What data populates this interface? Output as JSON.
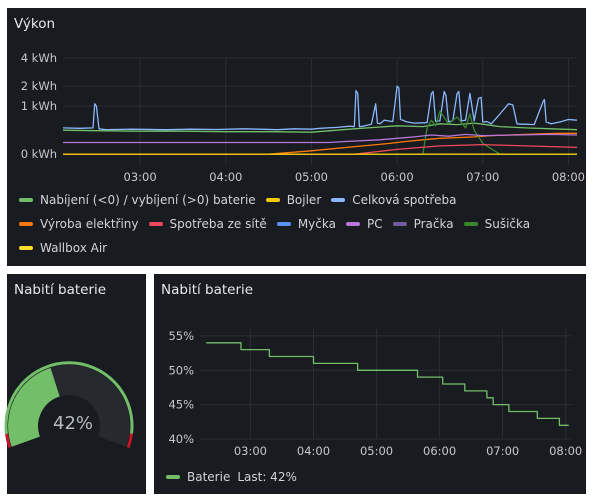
{
  "panels": {
    "vykon": {
      "title": "Výkon"
    },
    "gauge": {
      "title": "Nabití baterie",
      "value": 42,
      "value_text": "42%",
      "min": 0,
      "max": 100,
      "color": "#73bf69"
    },
    "battery": {
      "title": "Nabití baterie"
    }
  },
  "colors": {
    "bg": "#181b1f",
    "grid": "#2b2e33",
    "text": "#d8d9da"
  },
  "chart_data": [
    {
      "type": "line",
      "title": "Výkon",
      "y_ticks": [
        "4 kWh",
        "2 kWh",
        "1 kWh",
        "0 kWh"
      ],
      "y_tick_values": [
        4000,
        2000,
        1000,
        0
      ],
      "x_ticks": [
        "03:00",
        "04:00",
        "05:00",
        "06:00",
        "07:00",
        "08:00"
      ],
      "x_tick_values": [
        3,
        4,
        5,
        6,
        7,
        8
      ],
      "xlim": [
        2.1,
        8.1
      ],
      "y_scale": "sqrt",
      "ylim": [
        -50,
        4000
      ],
      "legend_rows": [
        [
          {
            "name": "Nabíjení (<0) / vybíjení (>0) baterie",
            "color": "#73bf69"
          },
          {
            "name": "Bojler",
            "color": "#f2cc0c"
          },
          {
            "name": "Celková spotřeba",
            "color": "#8ab8ff"
          }
        ],
        [
          {
            "name": "Výroba elektřiny",
            "color": "#ff780a"
          },
          {
            "name": "Spotřeba ze sítě",
            "color": "#f2495c"
          },
          {
            "name": "Myčka",
            "color": "#5794f2"
          },
          {
            "name": "PC",
            "color": "#b877d9"
          },
          {
            "name": "Pračka",
            "color": "#705da0"
          },
          {
            "name": "Sušička",
            "color": "#37872d"
          }
        ],
        [
          {
            "name": "Wallbox Air",
            "color": "#fade2a"
          }
        ]
      ],
      "series": [
        {
          "name": "Celková spotřeba",
          "color": "#8ab8ff",
          "x": [
            2.1,
            2.3,
            2.45,
            2.47,
            2.49,
            2.52,
            2.6,
            2.9,
            3.3,
            3.6,
            3.9,
            4.2,
            4.4,
            4.6,
            4.8,
            5.0,
            5.1,
            5.3,
            5.45,
            5.5,
            5.52,
            5.54,
            5.56,
            5.6,
            5.7,
            5.75,
            5.77,
            5.8,
            5.85,
            5.9,
            5.95,
            6.0,
            6.02,
            6.04,
            6.07,
            6.1,
            6.2,
            6.35,
            6.4,
            6.42,
            6.45,
            6.5,
            6.55,
            6.57,
            6.6,
            6.65,
            6.7,
            6.72,
            6.75,
            6.8,
            6.85,
            6.9,
            6.95,
            6.98,
            7.0,
            7.05,
            7.1,
            7.2,
            7.3,
            7.35,
            7.4,
            7.45,
            7.5,
            7.6,
            7.7,
            7.72,
            7.74,
            7.8,
            7.9,
            8.0,
            8.1
          ],
          "values": [
            300,
            290,
            300,
            1100,
            1000,
            280,
            260,
            270,
            260,
            270,
            265,
            280,
            270,
            260,
            280,
            270,
            290,
            310,
            340,
            330,
            1750,
            1600,
            330,
            340,
            390,
            1100,
            420,
            400,
            500,
            480,
            460,
            2000,
            1900,
            520,
            500,
            460,
            420,
            430,
            1600,
            1700,
            470,
            480,
            1700,
            1500,
            460,
            480,
            1600,
            1700,
            480,
            500,
            1600,
            480,
            1350,
            1400,
            450,
            460,
            400,
            700,
            1100,
            1050,
            400,
            390,
            390,
            380,
            1150,
            1300,
            450,
            400,
            450,
            520,
            500
          ]
        },
        {
          "name": "Nabíjení (<0) / vybíjení (>0) baterie",
          "color": "#73bf69",
          "x": [
            2.1,
            2.5,
            3.0,
            3.5,
            4.0,
            4.5,
            5.0,
            5.5,
            5.8,
            6.0,
            6.3,
            6.5,
            6.7,
            6.9,
            7.0,
            7.2,
            7.5,
            7.8,
            8.1
          ],
          "values": [
            250,
            240,
            230,
            230,
            220,
            220,
            210,
            280,
            320,
            350,
            330,
            400,
            380,
            420,
            390,
            330,
            300,
            280,
            260
          ]
        },
        {
          "name": "Výroba elektřiny",
          "color": "#ff780a",
          "x": [
            2.1,
            4.5,
            5.0,
            5.3,
            5.6,
            5.9,
            6.1,
            6.3,
            6.5,
            6.7,
            6.9,
            7.1,
            7.3,
            7.5,
            7.7,
            7.9,
            8.1
          ],
          "values": [
            0,
            0,
            5,
            15,
            30,
            50,
            70,
            90,
            110,
            120,
            130,
            150,
            160,
            170,
            180,
            190,
            190
          ]
        },
        {
          "name": "Sušička",
          "color": "#37872d",
          "x": [
            2.1,
            6.3,
            6.35,
            6.4,
            6.45,
            6.5,
            6.6,
            6.7,
            6.8,
            6.85,
            6.9,
            7.0,
            7.2,
            8.1
          ],
          "values": [
            0,
            0,
            300,
            500,
            350,
            800,
            400,
            600,
            300,
            700,
            250,
            50,
            0,
            0
          ]
        },
        {
          "name": "PC",
          "color": "#b877d9",
          "x": [
            2.1,
            5.2,
            5.4,
            5.8,
            6.0,
            6.2,
            6.4,
            6.6,
            6.8,
            7.0,
            7.4,
            7.8,
            8.1
          ],
          "values": [
            60,
            60,
            70,
            90,
            110,
            130,
            160,
            140,
            170,
            150,
            160,
            170,
            160
          ]
        },
        {
          "name": "Spotřeba ze sítě",
          "color": "#f2495c",
          "x": [
            2.1,
            5.5,
            6.0,
            6.5,
            7.0,
            7.5,
            8.1
          ],
          "values": [
            0,
            0,
            10,
            30,
            40,
            30,
            20
          ]
        },
        {
          "name": "Bojler",
          "color": "#f2cc0c",
          "x": [
            2.1,
            8.1
          ],
          "values": [
            0,
            0
          ]
        }
      ]
    },
    {
      "type": "line",
      "title": "Nabití baterie",
      "y_ticks": [
        "55%",
        "50%",
        "45%",
        "40%"
      ],
      "y_tick_values": [
        55,
        50,
        45,
        40
      ],
      "x_ticks": [
        "03:00",
        "04:00",
        "05:00",
        "06:00",
        "07:00",
        "08:00"
      ],
      "x_tick_values": [
        3,
        4,
        5,
        6,
        7,
        8
      ],
      "xlim": [
        2.2,
        8.1
      ],
      "ylim": [
        40,
        56
      ],
      "legend": [
        {
          "name": "Baterie",
          "extra": "Last: 42%",
          "color": "#73bf69"
        }
      ],
      "series": [
        {
          "name": "Baterie",
          "color": "#73bf69",
          "step": true,
          "x": [
            2.3,
            2.85,
            3.3,
            4.0,
            4.7,
            5.3,
            5.65,
            6.05,
            6.4,
            6.75,
            6.85,
            7.1,
            7.55,
            7.9,
            8.05
          ],
          "values": [
            54,
            53,
            52,
            51,
            50,
            50,
            49,
            48,
            47,
            46,
            45,
            44,
            43,
            42,
            42
          ]
        }
      ]
    }
  ]
}
